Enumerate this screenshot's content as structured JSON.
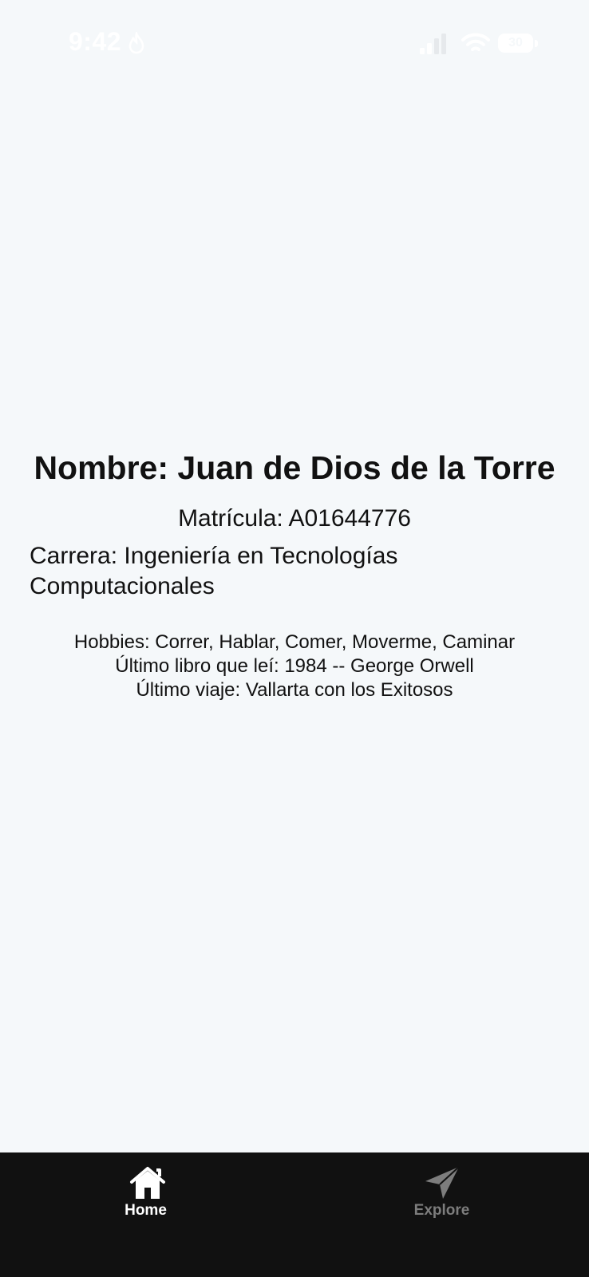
{
  "status_bar": {
    "time": "9:42",
    "battery": "30"
  },
  "profile": {
    "nombre": "Nombre: Juan de Dios de la Torre",
    "matricula": "Matrícula: A01644776",
    "carrera": "Carrera: Ingeniería en Tecnologías Computacionales",
    "hobbies": "Hobbies: Correr, Hablar, Comer, Moverme, Caminar",
    "ultimo_libro": "Último libro que leí: 1984 -- George Orwell",
    "ultimo_viaje": "Último viaje: Vallarta con los Exitosos"
  },
  "tabs": [
    {
      "label": "Home",
      "icon": "home-icon",
      "active": true
    },
    {
      "label": "Explore",
      "icon": "paper-plane-icon",
      "active": false
    }
  ],
  "colors": {
    "background": "#f5f8fa",
    "tab_bar": "#111111",
    "tab_active": "#ffffff",
    "tab_inactive": "#7d7d7d"
  }
}
